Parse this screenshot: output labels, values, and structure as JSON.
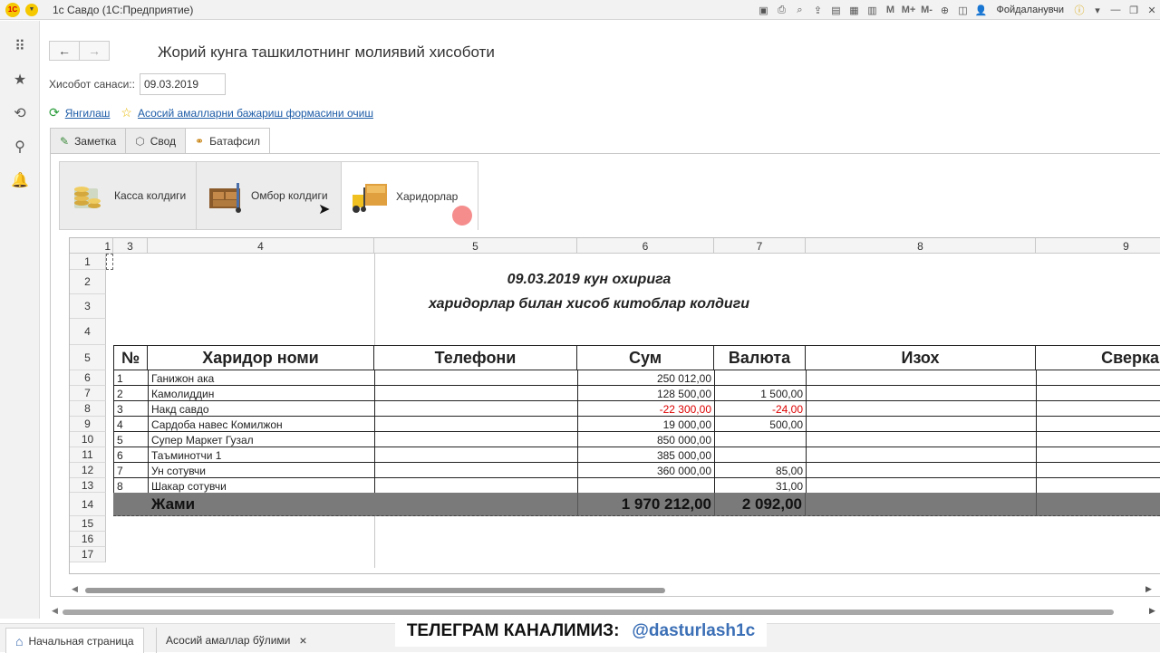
{
  "titlebar": {
    "logo": "1С",
    "app_title": "1с Савдо  (1С:Предприятие)",
    "m_labels": [
      "M",
      "M+",
      "M-"
    ],
    "user": "Фойдаланувчи"
  },
  "nav": {
    "back": "←",
    "forward": "→"
  },
  "form": {
    "title": "Жорий кунга ташкилотнинг молиявий хисоботи",
    "date_label": "Хисобот санаси::",
    "date_value": "09.03.2019",
    "refresh_link": "Янгилаш",
    "clear_link": "Асосий амалларни бажариш формасини очиш"
  },
  "tabs": [
    {
      "label": "Заметка",
      "icon": "pencil-icon"
    },
    {
      "label": "Свод",
      "icon": "cube-icon"
    },
    {
      "label": "Батафсил",
      "icon": "structure-icon"
    }
  ],
  "subtabs": [
    {
      "label": "Касса колдиги",
      "icon": "coins-icon"
    },
    {
      "label": "Омбор  колдиги",
      "icon": "warehouse-icon"
    },
    {
      "label": "Харидорлар",
      "icon": "forklift-icon"
    }
  ],
  "sheet": {
    "col_headers": [
      "1",
      "3",
      "4",
      "5",
      "6",
      "7",
      "8",
      "9"
    ],
    "row_headers": [
      "1",
      "2",
      "3",
      "4",
      "5",
      "6",
      "7",
      "8",
      "9",
      "10",
      "11",
      "12",
      "13",
      "14",
      "15",
      "16",
      "17"
    ],
    "report_title_1": "09.03.2019 кун охирига",
    "report_title_2": "харидорлар билан хисоб китоблар колдиги",
    "table_headers": {
      "no": "№",
      "name": "Харидор номи",
      "phone": "Телефони",
      "sum": "Сум",
      "currency": "Валюта",
      "note": "Изох",
      "check": "Сверка"
    },
    "rows": [
      {
        "no": "1",
        "name": "Ганижон ака",
        "sum": "250 012,00",
        "currency": ""
      },
      {
        "no": "2",
        "name": "Камолиддин",
        "sum": "128 500,00",
        "currency": "1 500,00"
      },
      {
        "no": "3",
        "name": "Накд савдо",
        "sum": "-22 300,00",
        "currency": "-24,00"
      },
      {
        "no": "4",
        "name": "Сардоба навес Комилжон",
        "sum": "19 000,00",
        "currency": "500,00"
      },
      {
        "no": "5",
        "name": "Супер Маркет Гузал",
        "sum": "850 000,00",
        "currency": ""
      },
      {
        "no": "6",
        "name": "Таъминотчи 1",
        "sum": "385 000,00",
        "currency": ""
      },
      {
        "no": "7",
        "name": "Ун сотувчи",
        "sum": "360 000,00",
        "currency": "85,00"
      },
      {
        "no": "8",
        "name": "Шакар сотувчи",
        "sum": "",
        "currency": "31,00"
      }
    ],
    "total": {
      "label": "Жами",
      "sum": "1 970 212,00",
      "currency": "2 092,00"
    }
  },
  "bottom_tabs": [
    {
      "label": "Начальная страница",
      "icon": "home-icon"
    },
    {
      "label": "Асосий амаллар бўлими",
      "close": "×"
    }
  ],
  "banner": {
    "text": "ТЕЛЕГРАМ КАНАЛИМИЗ:",
    "handle": "@dasturlash1c"
  },
  "colors": {
    "accent_yellow": "#f5c800",
    "link_blue": "#1b5aa6",
    "negative_red": "#d00000",
    "total_gray": "#7a7a7a"
  }
}
